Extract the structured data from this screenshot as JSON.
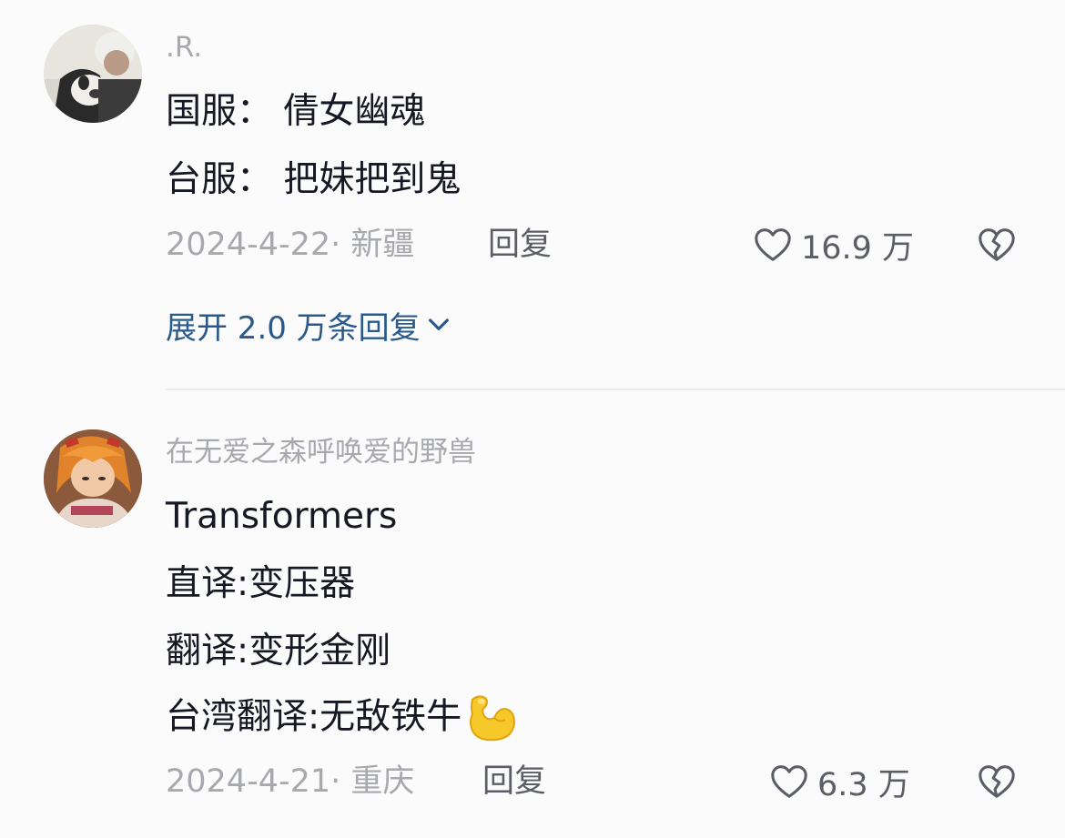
{
  "comments": [
    {
      "username": ".R.",
      "lines": [
        "国服：  倩女幽魂",
        "台服：  把妹把到鬼"
      ],
      "date_location": "2024-4-22· 新疆",
      "reply_label": "回复",
      "likes": "16.9 万",
      "expand_label": "展开 2.0 万条回复"
    },
    {
      "username": "在无爱之森呼唤爱的野兽",
      "lines": [
        "Transformers",
        "直译:变压器",
        "翻译:变形金刚",
        "台湾翻译:无敌铁牛"
      ],
      "emoji": "flexed-biceps",
      "date_location": "2024-4-21· 重庆",
      "reply_label": "回复",
      "likes": "6.3 万"
    }
  ],
  "colors": {
    "background": "#fbfbfb",
    "text": "#161823",
    "muted": "#a8a9ad",
    "action": "#5c5e66",
    "link": "#2a5a8c"
  }
}
